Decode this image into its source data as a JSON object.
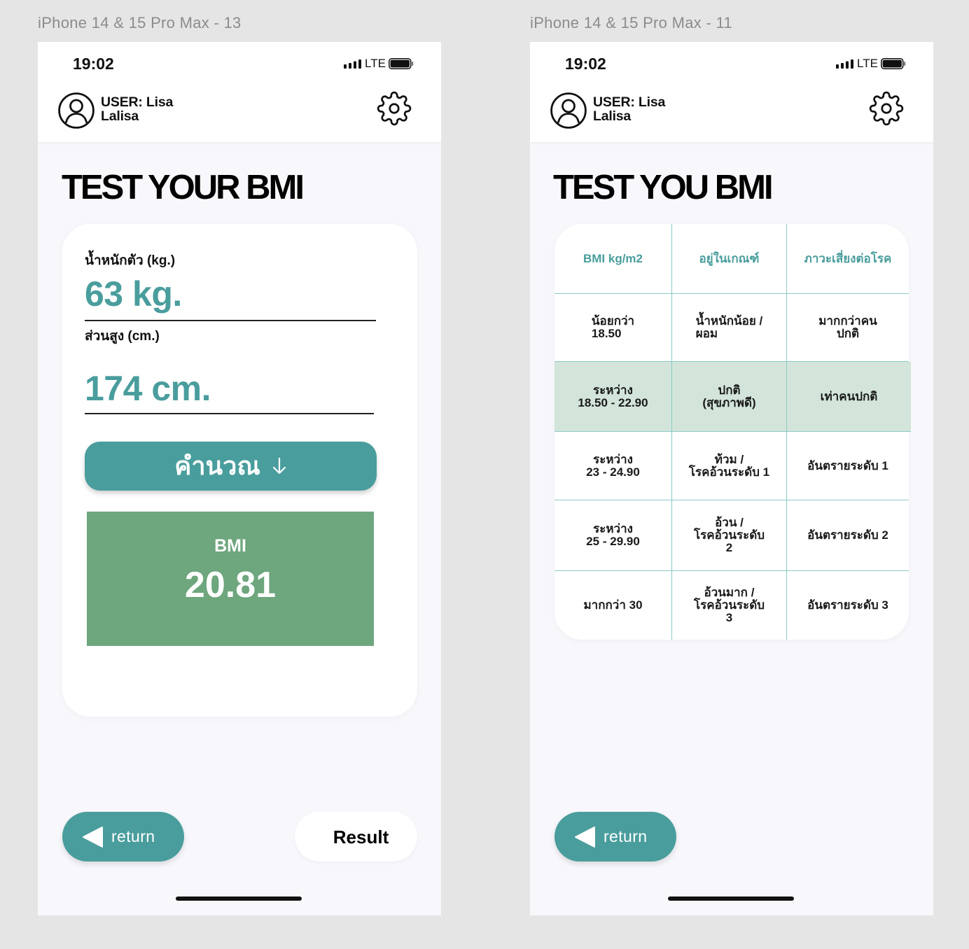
{
  "theme": {
    "canvas_bg": "#e5e5e5",
    "frame_label_color": "#8c8c8c",
    "screen_bg": "#f8f8fc",
    "accent": "#4a9d9d",
    "result_green": "#6ea67e",
    "highlight_row": "#d3e5da",
    "grid_line": "#8ccac6"
  },
  "screens": {
    "calculator": {
      "frame_label": "iPhone 14 & 15 Pro Max - 13",
      "status_bar": {
        "time": "19:02",
        "network": "LTE",
        "icons": [
          "signal-icon",
          "battery-icon"
        ]
      },
      "user": {
        "name_line1": "USER: Lisa",
        "name_line2": "Lalisa",
        "icon": "user-circle-icon"
      },
      "settings": {
        "icon": "gear-icon"
      },
      "title": "TEST YOUR BMI",
      "form": {
        "weight_label": "น้ำหนักตัว (kg.)",
        "weight_value": "63 kg.",
        "height_label": "ส่วนสูง (cm.)",
        "height_value": "174 cm."
      },
      "calculate_button": {
        "label": "คำนวณ",
        "icon": "arrow-down-icon"
      },
      "result": {
        "label": "BMI",
        "value": "20.81"
      },
      "return_button": {
        "label": "return",
        "icon": "triangle-left-icon"
      },
      "result_button": {
        "label": "Result"
      }
    },
    "table": {
      "frame_label": "iPhone 14 & 15 Pro Max - 11",
      "status_bar": {
        "time": "19:02",
        "network": "LTE",
        "icons": [
          "signal-icon",
          "battery-icon"
        ]
      },
      "user": {
        "name_line1": "USER: Lisa",
        "name_line2": "Lalisa",
        "icon": "user-circle-icon"
      },
      "settings": {
        "icon": "gear-icon"
      },
      "title": "TEST YOU BMI",
      "columns": [
        "BMI kg/m2",
        "อยู่ในเกณฑ์",
        "ภาวะเสี่ยงต่อโรค"
      ],
      "rows": [
        {
          "bmi": "น้อยกว่า\n18.50",
          "category": "น้ำหนักน้อย /\nผอม",
          "risk": "มากกว่าคน\nปกติ",
          "highlighted": false
        },
        {
          "bmi": "ระหว่าง\n18.50 - 22.90",
          "category": "ปกติ\n(สุขภาพดี)",
          "risk": "เท่าคนปกติ",
          "highlighted": true
        },
        {
          "bmi": "ระหว่าง\n23 - 24.90",
          "category": "ท้วม /\nโรคอ้วนระดับ 1",
          "risk": "อันตรายระดับ 1",
          "highlighted": false
        },
        {
          "bmi": "ระหว่าง\n25 - 29.90",
          "category": "อ้วน /\nโรคอ้วนระดับ\n2",
          "risk": "อันตรายระดับ 2",
          "highlighted": false
        },
        {
          "bmi": "มากกว่า 30",
          "category": "อ้วนมาก /\nโรคอ้วนระดับ\n3",
          "risk": "อันตรายระดับ 3",
          "highlighted": false
        }
      ],
      "return_button": {
        "label": "return",
        "icon": "triangle-left-icon"
      }
    }
  }
}
